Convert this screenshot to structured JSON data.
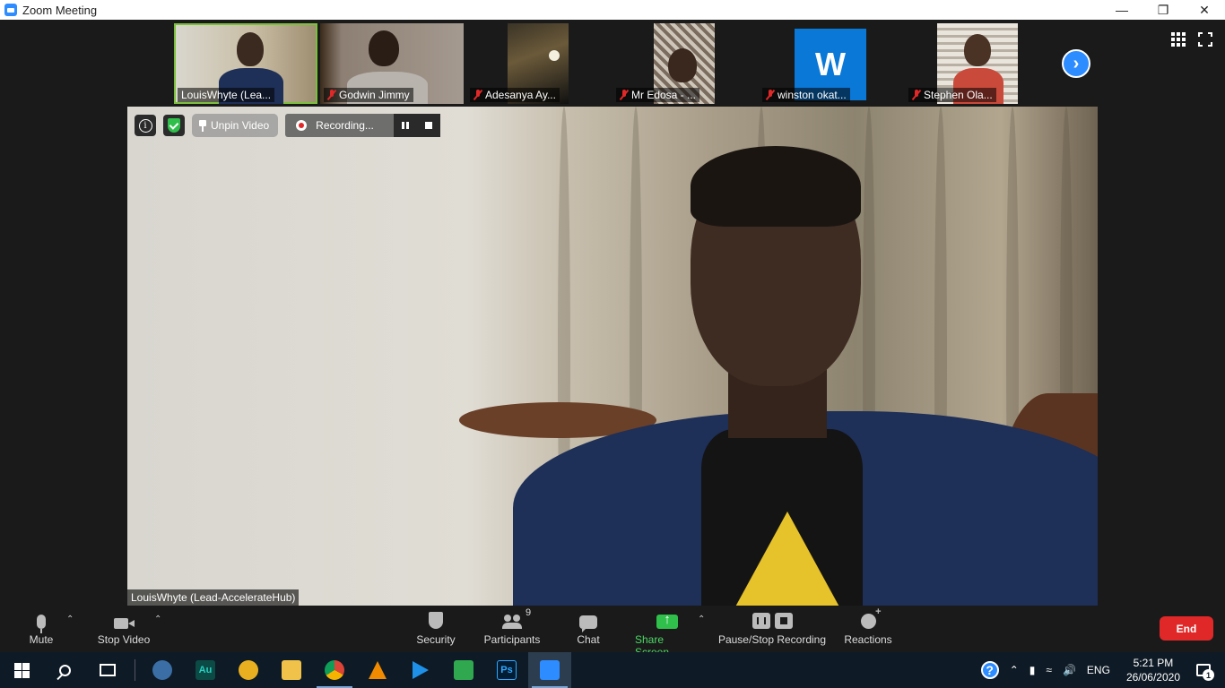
{
  "window": {
    "title": "Zoom Meeting",
    "controls": [
      "minimize",
      "restore",
      "close"
    ]
  },
  "gallery_strip": {
    "tiles": [
      {
        "name": "LouisWhyte (Lea...",
        "muted": false,
        "active": true
      },
      {
        "name": "Godwin Jimmy",
        "muted": true,
        "active": false
      },
      {
        "name": "Adesanya Ay...",
        "muted": true,
        "active": false
      },
      {
        "name": "Mr Edosa - ...",
        "muted": true,
        "active": false
      },
      {
        "name": "winston okat...",
        "muted": true,
        "active": false,
        "avatar_letter": "W"
      },
      {
        "name": "Stephen Ola...",
        "muted": true,
        "active": false
      }
    ],
    "next_icon": "chevron-right-icon"
  },
  "view_controls": {
    "gallery_icon": "grid-icon",
    "fullscreen_icon": "fullscreen-icon"
  },
  "main_video": {
    "speaker_name": "LouisWhyte (Lead-AccelerateHub)",
    "unpin_label": "Unpin Video",
    "recording_label": "Recording..."
  },
  "toolbar": {
    "mute_label": "Mute",
    "stop_video_label": "Stop Video",
    "security_label": "Security",
    "participants_label": "Participants",
    "participants_count": "9",
    "chat_label": "Chat",
    "share_screen_label": "Share Screen",
    "pause_stop_recording_label": "Pause/Stop Recording",
    "reactions_label": "Reactions",
    "end_label": "End"
  },
  "taskbar": {
    "apps": [
      {
        "name": "Cortana",
        "label": ""
      },
      {
        "name": "Audition",
        "label": "Au"
      },
      {
        "name": "App",
        "label": ""
      },
      {
        "name": "File Explorer",
        "label": ""
      },
      {
        "name": "Chrome",
        "label": ""
      },
      {
        "name": "VLC",
        "label": ""
      },
      {
        "name": "Play",
        "label": ""
      },
      {
        "name": "Draw",
        "label": ""
      },
      {
        "name": "Photoshop",
        "label": "Ps"
      },
      {
        "name": "Zoom",
        "label": ""
      }
    ],
    "language": "ENG",
    "time": "5:21 PM",
    "date": "26/06/2020",
    "notification_count": "1"
  },
  "colors": {
    "zoom_blue": "#2d8cff",
    "end_red": "#e02828",
    "share_green": "#2fbf4a",
    "active_tile_border": "#7cbf3d",
    "taskbar_bg": "#0e1a25"
  }
}
